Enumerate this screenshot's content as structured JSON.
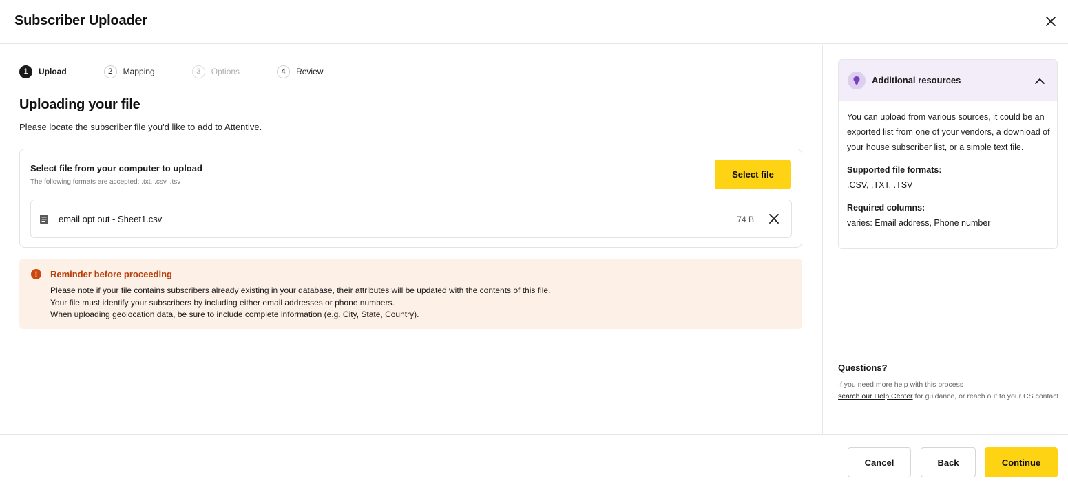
{
  "header": {
    "title": "Subscriber Uploader",
    "close_icon": "close-icon"
  },
  "stepper": {
    "steps": [
      {
        "number": "1",
        "label": "Upload",
        "state": "active"
      },
      {
        "number": "2",
        "label": "Mapping",
        "state": "default"
      },
      {
        "number": "3",
        "label": "Options",
        "state": "disabled"
      },
      {
        "number": "4",
        "label": "Review",
        "state": "default"
      }
    ]
  },
  "main": {
    "heading": "Uploading your file",
    "subheading": "Please locate the subscriber file you'd like to add to Attentive."
  },
  "upload_card": {
    "title": "Select file from your computer to upload",
    "formats": "The following formats are accepted: .txt, .csv, .tsv",
    "select_button": "Select file",
    "file": {
      "icon": "document-icon",
      "name": "email opt out - Sheet1.csv",
      "size": "74 B",
      "remove_icon": "close-icon"
    }
  },
  "reminder": {
    "icon": "alert-icon",
    "icon_glyph": "!",
    "title": "Reminder before proceeding",
    "lines": [
      "Please note if your file contains subscribers already existing in your database, their attributes will be updated with the contents of this file.",
      "Your file must identify your subscribers by including either email addresses or phone numbers.",
      "When uploading geolocation data, be sure to include complete information (e.g. City, State, Country)."
    ]
  },
  "resources": {
    "title": "Additional resources",
    "icon": "lightbulb-icon",
    "collapse_icon": "chevron-up-icon",
    "description": "You can upload from various sources, it could be an exported list from one of your vendors, a download of your house subscriber list, or a simple text file.",
    "formats_label": "Supported file formats:",
    "formats_value": ".CSV, .TXT, .TSV",
    "columns_label": "Required columns:",
    "columns_value": "varies: Email address, Phone number"
  },
  "questions": {
    "title": "Questions?",
    "line1": "If you need more help with this process",
    "link": "search our Help Center",
    "line2": " for guidance, or reach out to your CS contact."
  },
  "footer": {
    "cancel": "Cancel",
    "back": "Back",
    "continue": "Continue"
  },
  "colors": {
    "primary_yellow": "#fed314",
    "reminder_bg": "#fdf0e6",
    "reminder_accent": "#c9490e",
    "resources_header_bg": "#f3ecf9",
    "bulb_purple": "#7b3fc4"
  }
}
